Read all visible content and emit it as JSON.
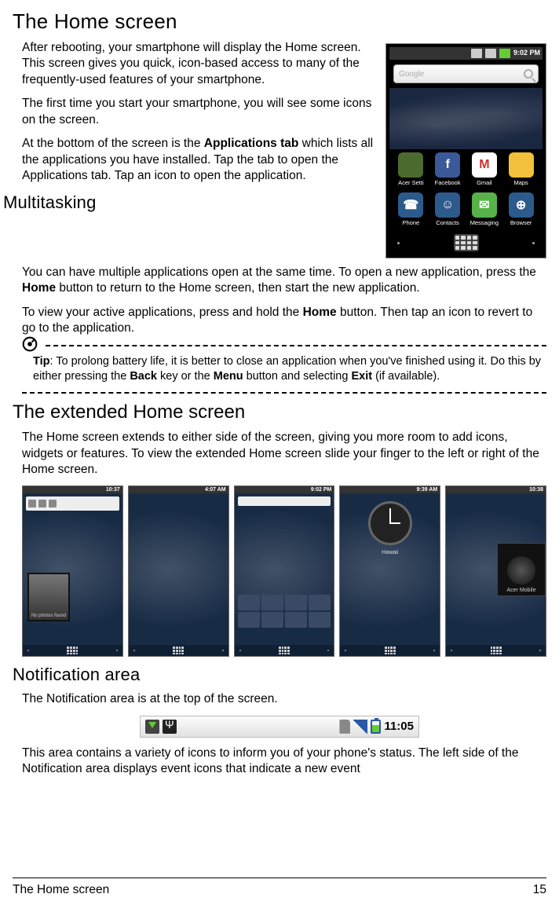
{
  "page": {
    "footer_title": "The Home screen",
    "page_number": "15"
  },
  "sections": {
    "home": {
      "title": "The Home screen",
      "p1": "After rebooting, your smartphone will display the Home screen. This screen gives you quick, icon-based access to many of the frequently-used features of your smartphone.",
      "p2": "The first time you start your smartphone, you will see some icons on the screen.",
      "p3a": "At the bottom of the screen is the ",
      "p3_bold": "Applications tab",
      "p3b": " which lists all the applications you have installed. Tap the tab to open the Applications tab. Tap an icon to open the application."
    },
    "multi": {
      "title": "Multitasking",
      "p1a": "You can have multiple applications open at the same time. To open a new application, press the ",
      "p1_bold1": "Home",
      "p1b": " button to return to the Home screen, then start the new application.",
      "p2a": "To view your active applications, press and hold the ",
      "p2_bold1": "Home",
      "p2b": " button. Then tap an icon to revert to go to the application."
    },
    "tip": {
      "label": "Tip",
      "t1": ": To prolong battery life, it is better to close an application when you've finished using it. Do this by either pressing the ",
      "b1": "Back",
      "t2": " key or the ",
      "b2": "Menu",
      "t3": " button and selecting ",
      "b3": "Exit",
      "t4": " (if available)."
    },
    "ext": {
      "title": "The extended Home screen",
      "p1": "The Home screen extends to either side of the screen, giving you more room to add icons, widgets or features. To view the extended Home screen slide your finger to the left or right of the Home screen."
    },
    "notif": {
      "title": "Notification area",
      "p1": "The Notification area is at the top of the screen.",
      "p2": "This area contains a variety of icons to inform you of your phone's status. The left side of the Notification area displays event icons that indicate a new event"
    }
  },
  "phone_main": {
    "status_time": "9:02 PM",
    "search_label": "Google",
    "apps_row1": [
      {
        "label": "Acer Setti",
        "color": "#4b6b2e"
      },
      {
        "label": "Facebook",
        "color": "#3b5998",
        "letter": "f"
      },
      {
        "label": "Gmail",
        "color": "#fff",
        "letter": "M"
      },
      {
        "label": "Maps",
        "color": "#f2c03a"
      }
    ],
    "apps_row2": [
      {
        "label": "Phone",
        "color": "#2d5a8c",
        "letter": "☎"
      },
      {
        "label": "Contacts",
        "color": "#2d5a8c",
        "letter": "☺"
      },
      {
        "label": "Messaging",
        "color": "#58b24a",
        "letter": "✉"
      },
      {
        "label": "Browser",
        "color": "#2d5a8c",
        "letter": "⊕"
      }
    ]
  },
  "thumbs": {
    "times": [
      "10:37",
      "4:07 AM",
      "9:02 PM",
      "9:39 AM",
      "10:38"
    ],
    "photo_label": "No photos found",
    "clock_city": "Hawaii",
    "acer_label": "Acer Mobile"
  },
  "notif_bar": {
    "time": "11:05"
  }
}
